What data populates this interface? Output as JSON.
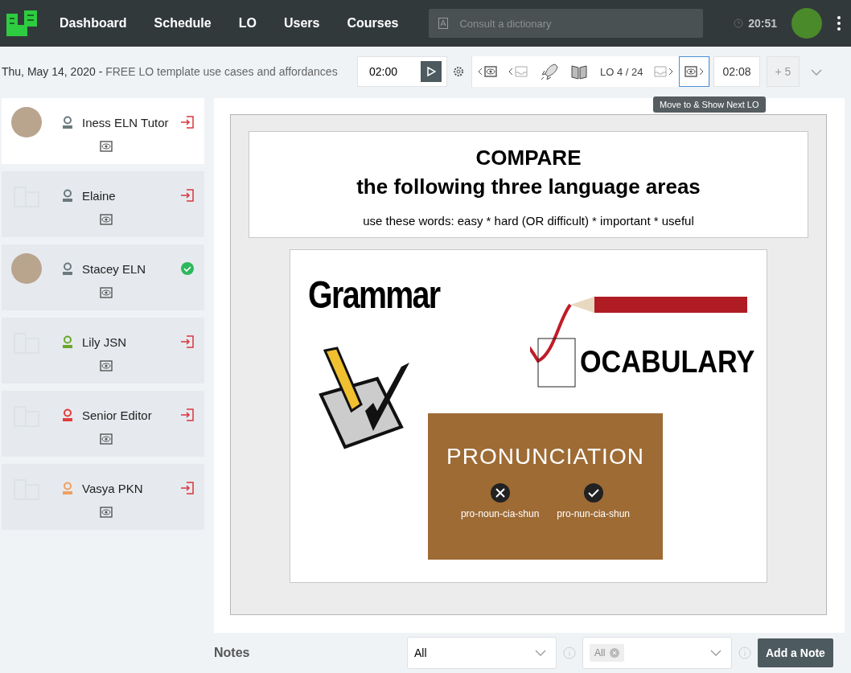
{
  "nav": {
    "items": [
      {
        "label": "Dashboard"
      },
      {
        "label": "Schedule"
      },
      {
        "label": "LO"
      },
      {
        "label": "Users"
      },
      {
        "label": "Courses"
      }
    ],
    "search": {
      "placeholder": "Consult a dictionary"
    },
    "time": "20:51"
  },
  "header": {
    "date": "Thu, May 14, 2020",
    "separator": " - ",
    "title": "FREE LO template use cases and affordances"
  },
  "toolbar": {
    "timer": "02:00",
    "counter": "LO 4 / 24",
    "next_selected": true,
    "elapsed": "02:08",
    "extra": "+ 5",
    "extra_disabled": true,
    "tooltip": "Move to & Show Next LO"
  },
  "participants": [
    {
      "name": "Iness ELN Tutor",
      "kind": "photo",
      "color": "#6c7a7d",
      "checked": false,
      "selected": true
    },
    {
      "name": "Elaine",
      "kind": "placeholder",
      "color": "#6c7a7d",
      "checked": false,
      "selected": false
    },
    {
      "name": "Stacey ELN",
      "kind": "photo",
      "color": "#6c7a7d",
      "checked": true,
      "selected": false
    },
    {
      "name": "Lily JSN",
      "kind": "placeholder",
      "color": "#6aa82a",
      "checked": false,
      "selected": false
    },
    {
      "name": "Senior Editor",
      "kind": "placeholder",
      "color": "#e03c3c",
      "checked": false,
      "selected": false
    },
    {
      "name": "Vasya PKN",
      "kind": "placeholder",
      "color": "#f0a060",
      "checked": false,
      "selected": false
    }
  ],
  "slide": {
    "heading": "COMPARE",
    "subheading": "the following three language areas",
    "instruction": "use these words: easy * hard (OR difficult) * important * useful",
    "grammar": "Grammar",
    "vocabulary": "OCABULARY",
    "pronunciation": "PRONUNCIATION",
    "wrong": "pro-noun-cia-shun",
    "right": "pro-nun-cia-shun"
  },
  "notes": {
    "label": "Notes",
    "filter": "All",
    "tag": "All",
    "button": "Add a Note"
  }
}
